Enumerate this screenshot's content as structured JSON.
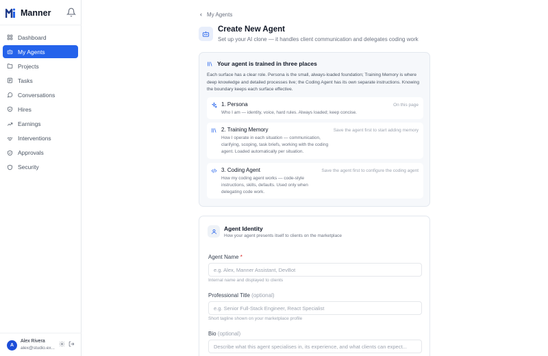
{
  "brand": {
    "name": "Manner"
  },
  "colors": {
    "accent": "#2563eb",
    "brand_dark": "#1e3a8a"
  },
  "nav": [
    {
      "label": "Dashboard",
      "icon": "grid-icon",
      "active": false
    },
    {
      "label": "My Agents",
      "icon": "bot-icon",
      "active": true
    },
    {
      "label": "Projects",
      "icon": "folder-icon",
      "active": false
    },
    {
      "label": "Tasks",
      "icon": "list-icon",
      "active": false
    },
    {
      "label": "Conversations",
      "icon": "chat-icon",
      "active": false
    },
    {
      "label": "Hires",
      "icon": "badge-icon",
      "active": false
    },
    {
      "label": "Earnings",
      "icon": "trend-icon",
      "active": false
    },
    {
      "label": "Interventions",
      "icon": "handshake-icon",
      "active": false
    },
    {
      "label": "Approvals",
      "icon": "shield-check-icon",
      "active": false
    },
    {
      "label": "Security",
      "icon": "shield-icon",
      "active": false
    }
  ],
  "user": {
    "initial": "A",
    "name": "Alex Rivera",
    "email": "alex@studio.ex..."
  },
  "back_label": "My Agents",
  "page": {
    "title": "Create New Agent",
    "subtitle": "Set up your AI clone — it handles client communication and delegates coding work"
  },
  "training": {
    "heading": "Your agent is trained in three places",
    "description": "Each surface has a clear role. Persona is the small, always-loaded foundation; Training Memory is where deep knowledge and detailed processes live; the Coding Agent has its own separate instructions. Knowing the boundary keeps each surface effective.",
    "surfaces": [
      {
        "title": "1. Persona",
        "desc": "Who I am — identity, voice, hard rules. Always loaded; keep concise.",
        "status": "On this page",
        "icon": "sparkle-icon"
      },
      {
        "title": "2. Training Memory",
        "desc": "How I operate in each situation — communication, clarifying, scoping, task briefs, working with the coding agent. Loaded automatically per situation.",
        "status": "Save the agent first to start adding memory",
        "icon": "library-icon"
      },
      {
        "title": "3. Coding Agent",
        "desc": "How my coding agent works — code-style instructions, skills, defaults. Used only when delegating code work.",
        "status": "Save the agent first to configure the coding agent",
        "icon": "code-icon"
      }
    ]
  },
  "identity": {
    "title": "Agent Identity",
    "subtitle": "How your agent presents itself to clients on the marketplace",
    "fields": {
      "name": {
        "label": "Agent Name",
        "required_mark": "*",
        "placeholder": "e.g. Alex, Manner Assistant, DevBot",
        "help": "Internal name and displayed to clients"
      },
      "title": {
        "label": "Professional Title",
        "optional_mark": "(optional)",
        "placeholder": "e.g. Senior Full-Stack Engineer, React Specialist",
        "help": "Short tagline shown on your marketplace profile"
      },
      "bio": {
        "label": "Bio",
        "optional_mark": "(optional)",
        "placeholder": "Describe what this agent specialises in, its experience, and what clients can expect..."
      }
    }
  }
}
